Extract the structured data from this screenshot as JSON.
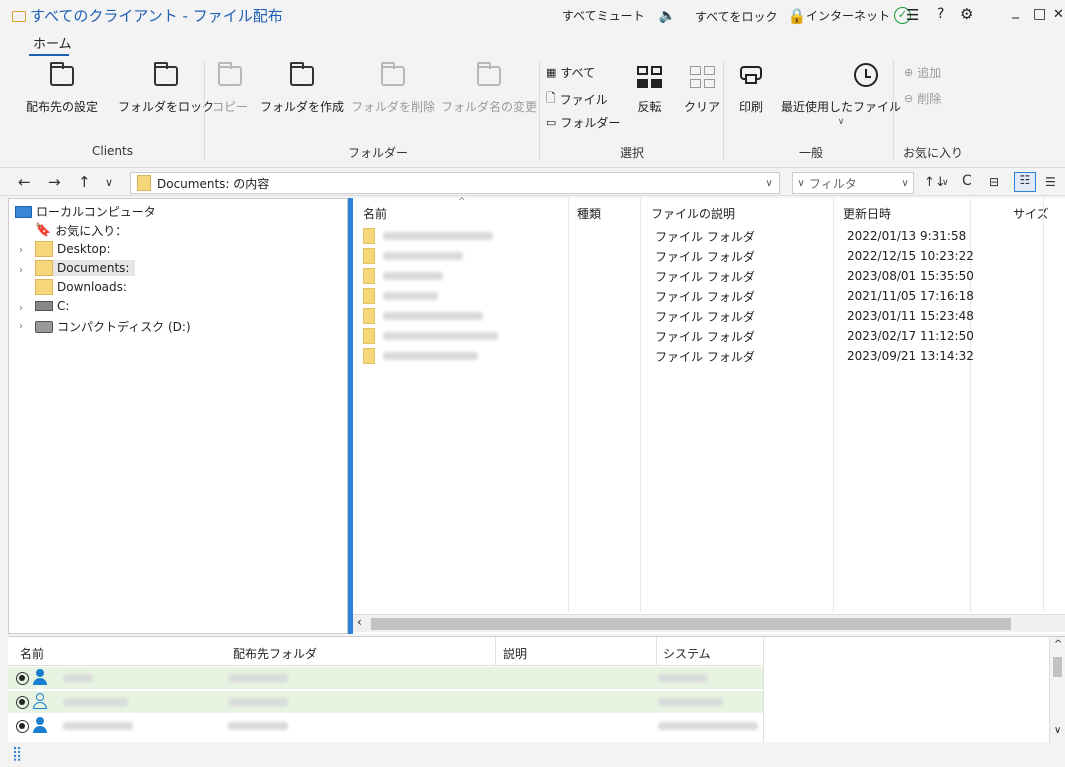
{
  "titlebar": {
    "title": "すべてのクライアント - ファイル配布",
    "mute_all": "すべてミュート",
    "lock_all": "すべてをロック",
    "internet": "インターネット",
    "menu_glyph": "☰",
    "help_glyph": "?",
    "settings_glyph": "⚙",
    "minimize_glyph": "_",
    "maximize_glyph": "□",
    "close_glyph": "✕"
  },
  "menu": {
    "home_tab": "ホーム"
  },
  "ribbon": {
    "buttons": {
      "set_destination": "配布先の設定",
      "lock_folder": "フォルダをロック",
      "copy": "コピー",
      "create_folder": "フォルダを作成",
      "delete_folder": "フォルダを削除",
      "rename_folder": "フォルダ名の変更",
      "select_all": "すべて",
      "select_files": "ファイル",
      "select_folders": "フォルダー",
      "invert": "反転",
      "clear": "クリア",
      "print": "印刷",
      "recent_files": "最近使用したファイル",
      "fav_add": "追加",
      "fav_remove": "削除"
    },
    "groups": {
      "clients": "Clients",
      "folder": "フォルダー",
      "select": "選択",
      "general": "一般",
      "favorites": "お気に入り"
    }
  },
  "address": {
    "back": "←",
    "forward": "→",
    "up": "↑",
    "history": "∨",
    "path": "Documents: の内容",
    "filter_placeholder": "フィルタ",
    "sort_glyph": "↑↓",
    "refresh_glyph": "C"
  },
  "tree": {
    "root": "ローカルコンピュータ",
    "favorites": "お気に入り：",
    "desktop": "Desktop:",
    "documents": "Documents:",
    "downloads": "Downloads:",
    "c_drive": "C:",
    "d_drive": "コンパクトディスク (D:)"
  },
  "file_list": {
    "columns": {
      "name": "名前",
      "type": "種類",
      "description": "ファイルの説明",
      "modified": "更新日時",
      "size": "サイズ"
    },
    "rows": [
      {
        "description": "ファイル フォルダ",
        "modified": "2022/01/13 9:31:58"
      },
      {
        "description": "ファイル フォルダ",
        "modified": "2022/12/15 10:23:22"
      },
      {
        "description": "ファイル フォルダ",
        "modified": "2023/08/01 15:35:50"
      },
      {
        "description": "ファイル フォルダ",
        "modified": "2021/11/05 17:16:18"
      },
      {
        "description": "ファイル フォルダ",
        "modified": "2023/01/11 15:23:48"
      },
      {
        "description": "ファイル フォルダ",
        "modified": "2023/02/17 11:12:50"
      },
      {
        "description": "ファイル フォルダ",
        "modified": "2023/09/21 13:14:32"
      }
    ]
  },
  "clients": {
    "columns": {
      "name": "名前",
      "dest_folder": "配布先フォルダ",
      "description": "説明",
      "system": "システム"
    }
  },
  "colors": {
    "accent": "#1f5fb4",
    "panel_divider": "#2c82d8",
    "folder": "#f5d77a",
    "client_row": "#e6f4e1",
    "user_icon": "#1a7fd0"
  }
}
